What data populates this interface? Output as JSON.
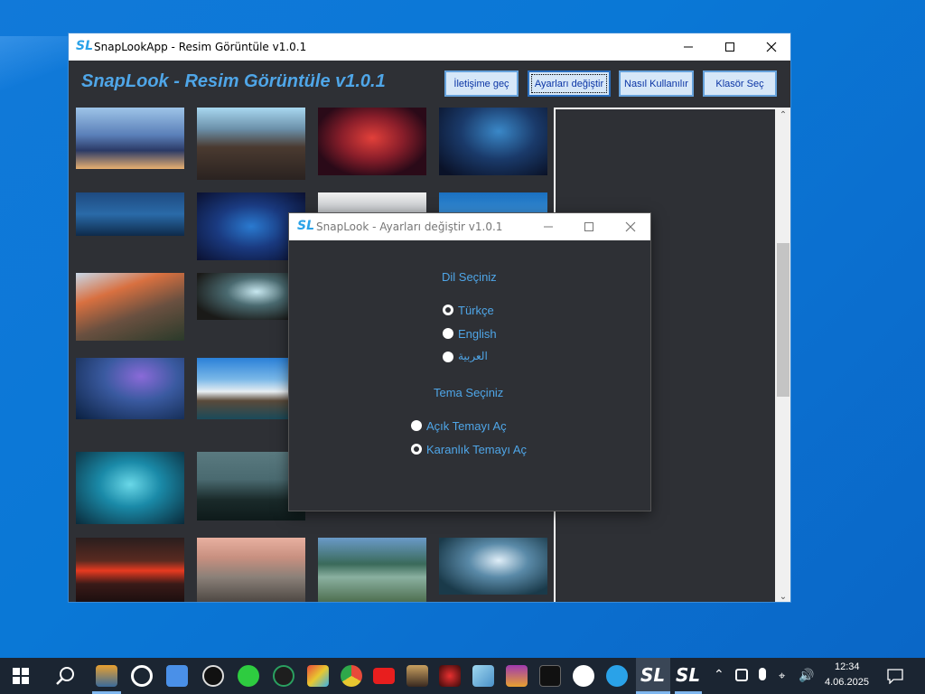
{
  "main_window": {
    "title": "SnapLookApp - Resim Görüntüle v1.0.1",
    "app_icon_text": "SL",
    "header_title": "SnapLook - Resim Görüntüle v1.0.1",
    "buttons": [
      "İletişime geç",
      "Ayarları değiştir",
      "Nasıl Kullanılır",
      "Klasör Seç"
    ]
  },
  "dialog": {
    "title": "SnapLook - Ayarları değiştir v1.0.1",
    "app_icon_text": "SL",
    "language_heading": "Dil Seçiniz",
    "languages": [
      {
        "label": "Türkçe",
        "selected": true
      },
      {
        "label": "English",
        "selected": false
      },
      {
        "label": "العربية",
        "selected": false
      }
    ],
    "theme_heading": "Tema Seçiniz",
    "themes": [
      {
        "label": "Açık Temayı Aç",
        "selected": false
      },
      {
        "label": "Karanlık Temayı Aç",
        "selected": true
      }
    ]
  },
  "thumbnails": [
    "sci-fi-city",
    "japanese-street",
    "red-nebula",
    "blue-space",
    "lake-night",
    "blue-galaxy",
    "snowy-mountain",
    "blue-sky",
    "el-capitan",
    "cave-waterfall",
    "",
    "",
    "fantasy-forest",
    "mountain-lake",
    "",
    "",
    "ice-cave",
    "dark-mountains",
    "",
    "",
    "sunset-rails",
    "half-dome",
    "river-valley",
    "cloudy-sky"
  ],
  "taskbar": {
    "apps": [
      "film-icon",
      "steam-icon",
      "finder-icon",
      "obs-icon",
      "whatsapp-icon",
      "gamepass-icon",
      "paint-icon",
      "chrome-icon",
      "youtube-icon",
      "media-icon",
      "eye-icon",
      "notes-icon",
      "winrar-icon",
      "capcut-icon",
      "github-icon",
      "telegram-icon",
      "snaplook-icon",
      "snaplook-icon"
    ],
    "time": "12:34",
    "date": "4.06.2025"
  }
}
